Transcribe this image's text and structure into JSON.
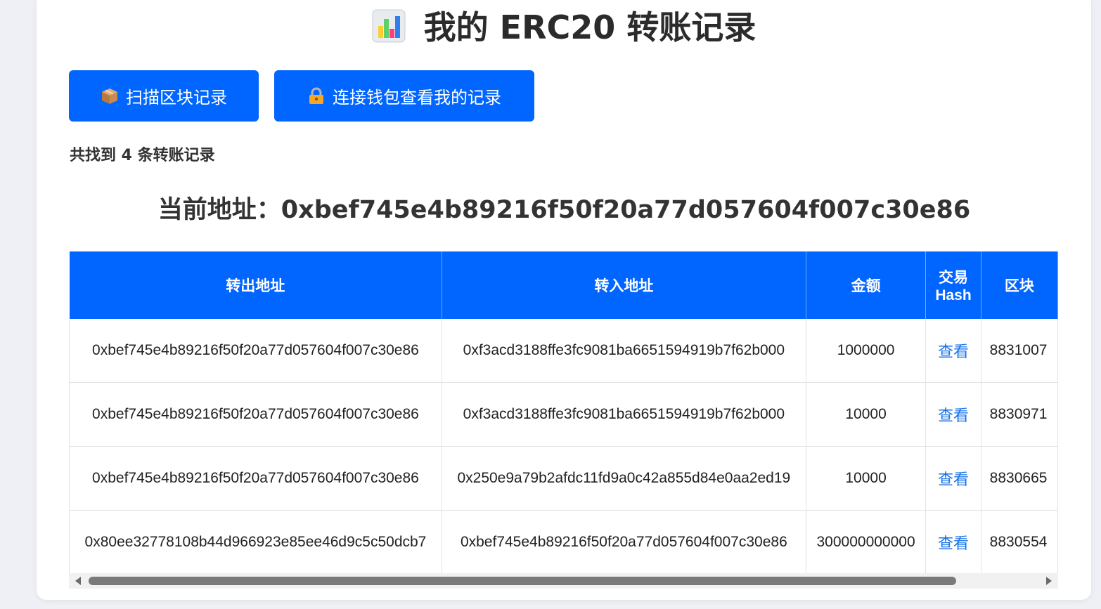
{
  "header": {
    "icon": "bar-chart-icon",
    "title": "我的 ERC20 转账记录"
  },
  "actions": {
    "scan": {
      "icon": "package-icon",
      "label": "扫描区块记录"
    },
    "wallet": {
      "icon": "lock-icon",
      "label": "连接钱包查看我的记录"
    }
  },
  "summary": {
    "count_text": "共找到 4 条转账记录",
    "current_address": "当前地址：0xbef745e4b89216f50f20a77d057604f007c30e86"
  },
  "table": {
    "headers": [
      "转出地址",
      "转入地址",
      "金额",
      "交易 Hash",
      "区块"
    ],
    "rows": [
      {
        "from": "0xbef745e4b89216f50f20a77d057604f007c30e86",
        "to": "0xf3acd3188ffe3fc9081ba6651594919b7f62b000",
        "amount": "1000000",
        "hash_link": "查看",
        "block": "8831007"
      },
      {
        "from": "0xbef745e4b89216f50f20a77d057604f007c30e86",
        "to": "0xf3acd3188ffe3fc9081ba6651594919b7f62b000",
        "amount": "10000",
        "hash_link": "查看",
        "block": "8830971"
      },
      {
        "from": "0xbef745e4b89216f50f20a77d057604f007c30e86",
        "to": "0x250e9a79b2afdc11fd9a0c42a855d84e0aa2ed19",
        "amount": "10000",
        "hash_link": "查看",
        "block": "8830665"
      },
      {
        "from": "0x80ee32778108b44d966923e85ee46d9c5c50dcb7",
        "to": "0xbef745e4b89216f50f20a77d057604f007c30e86",
        "amount": "300000000000",
        "hash_link": "查看",
        "block": "8830554"
      }
    ]
  },
  "colors": {
    "primary": "#0066ff",
    "link": "#1a73e8",
    "text": "#333333",
    "background": "#eef0f5"
  }
}
